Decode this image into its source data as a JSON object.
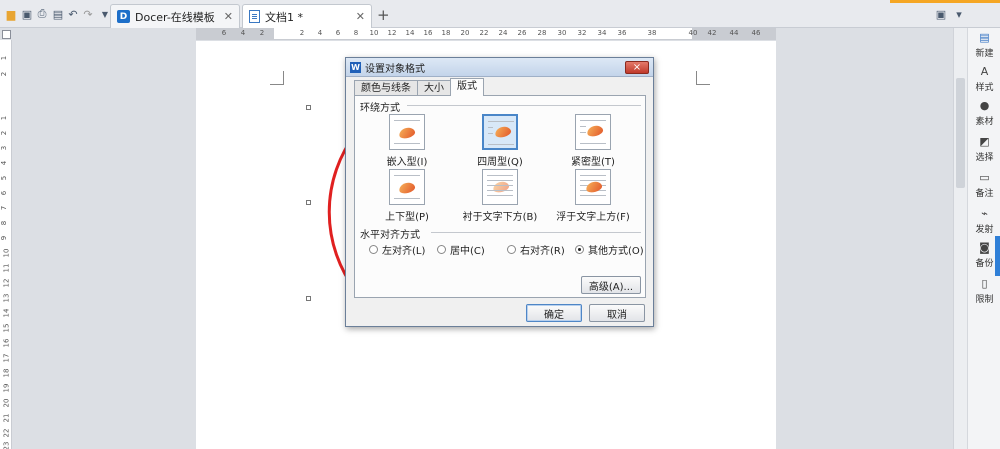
{
  "toolbar": {
    "quick_access_icons": [
      "folder-icon",
      "save-icon",
      "print-icon",
      "print-preview-icon",
      "undo-icon",
      "redo-icon",
      "dropdown-arrow-icon"
    ],
    "tabs": [
      {
        "label": "Docer-在线模板",
        "icon": "docer-logo-icon",
        "active": false
      },
      {
        "label": "文档1 *",
        "icon": "document-icon",
        "active": true
      }
    ],
    "new_tab_label": "+",
    "accent_color": "#f5a623"
  },
  "ruler": {
    "left_numbers": [
      "6",
      "4",
      "2"
    ],
    "right_numbers": [
      "2",
      "4",
      "6",
      "8",
      "10",
      "12",
      "14",
      "16",
      "18",
      "20",
      "22",
      "24",
      "26",
      "28",
      "30",
      "32",
      "34",
      "36",
      "38",
      "40",
      "42",
      "44",
      "46"
    ],
    "vertical_numbers": [
      "1",
      "2",
      "1",
      "2",
      "3",
      "4",
      "5",
      "6",
      "7",
      "8",
      "9",
      "10",
      "11",
      "12",
      "13",
      "14",
      "15",
      "16",
      "17",
      "18",
      "19",
      "20",
      "21",
      "22",
      "23"
    ]
  },
  "sidebar": {
    "items": [
      {
        "label": "新建",
        "icon": "new-doc-icon"
      },
      {
        "label": "样式",
        "icon": "style-icon"
      },
      {
        "label": "素材",
        "icon": "material-icon"
      },
      {
        "label": "选择",
        "icon": "select-icon"
      },
      {
        "label": "备注",
        "icon": "note-icon"
      },
      {
        "label": "发射",
        "icon": "send-icon"
      },
      {
        "label": "备份",
        "icon": "backup-icon"
      },
      {
        "label": "限制",
        "icon": "restrict-icon"
      }
    ]
  },
  "dialog": {
    "title": "设置对象格式",
    "close_label": "×",
    "tabs": [
      "颜色与线条",
      "大小",
      "版式"
    ],
    "active_tab": "版式",
    "wrap_section_label": "环绕方式",
    "wrap_options": [
      {
        "label": "嵌入型(I)",
        "selected": false
      },
      {
        "label": "四周型(Q)",
        "selected": true
      },
      {
        "label": "紧密型(T)",
        "selected": false
      },
      {
        "label": "上下型(P)",
        "selected": false
      },
      {
        "label": "衬于文字下方(B)",
        "selected": false
      },
      {
        "label": "浮于文字上方(F)",
        "selected": false
      }
    ],
    "align_section_label": "水平对齐方式",
    "align_options": [
      {
        "label": "左对齐(L)",
        "checked": false
      },
      {
        "label": "居中(C)",
        "checked": false
      },
      {
        "label": "右对齐(R)",
        "checked": false
      },
      {
        "label": "其他方式(O)",
        "checked": true
      }
    ],
    "advanced_button": "高级(A)...",
    "ok_button": "确定",
    "cancel_button": "取消"
  },
  "shape_color": "#e02020"
}
